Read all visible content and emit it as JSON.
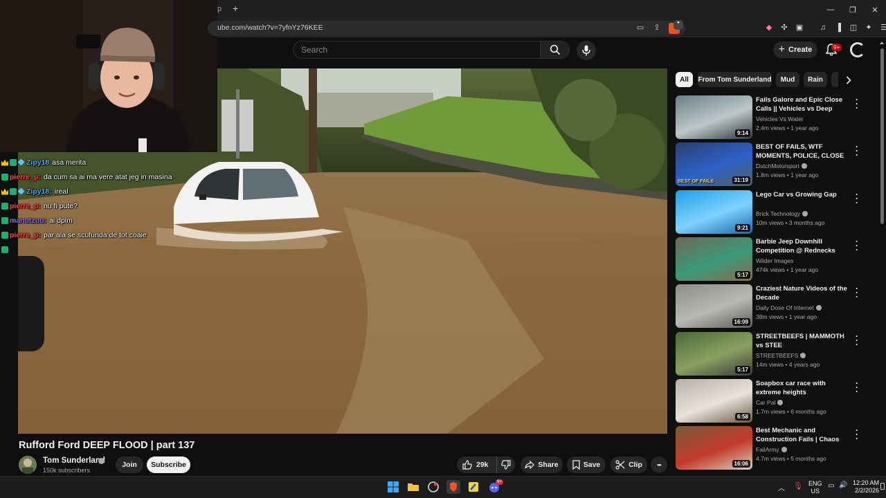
{
  "browser": {
    "tab_fragment": "p",
    "new_tab": "+",
    "url": "ube.com/watch?v=7yfnYz76KEE",
    "brave_badge": "●",
    "window_controls": [
      "—",
      "❐",
      "✕"
    ]
  },
  "header": {
    "search_placeholder": "Search",
    "create_label": "Create",
    "notifications_badge": "9+"
  },
  "chat": [
    {
      "badges": [
        "crown",
        "green",
        "diamond"
      ],
      "name": "Zipy18",
      "name_color": "blue",
      "message": "asa merita"
    },
    {
      "badges": [
        "green"
      ],
      "name": "pierre_p:",
      "name_color": "red",
      "message": "da cum sa ai ma vere atat jeg in masina"
    },
    {
      "badges": [
        "crown",
        "green",
        "diamond"
      ],
      "name": "Zipy18:",
      "name_color": "blue",
      "message": "ireal"
    },
    {
      "badges": [
        "green"
      ],
      "name": "pierre_p:",
      "name_color": "red",
      "message": "nu fi pute?"
    },
    {
      "badges": [
        "green"
      ],
      "name": "manutzuu:",
      "name_color": "purple",
      "message": "ai dplm"
    },
    {
      "badges": [
        "green"
      ],
      "name": "pierre_p:",
      "name_color": "red",
      "message": "par ala se scufunda de tot coaie"
    },
    {
      "badges": [
        "green"
      ],
      "name": "",
      "name_color": "red",
      "message": ""
    }
  ],
  "video": {
    "title": "Rufford Ford DEEP FLOOD | part 137",
    "channel": "Tom Sunderland",
    "subscribers": "150k subscribers",
    "join_label": "Join",
    "subscribe_label": "Subscribe",
    "likes": "29k",
    "share_label": "Share",
    "save_label": "Save",
    "clip_label": "Clip",
    "more_label": "•••"
  },
  "chips": [
    "All",
    "From Tom Sunderland",
    "Mud",
    "Rain"
  ],
  "recommendations": [
    {
      "title": "Fails Galore and Epic Close Calls || Vehicles vs Deep Water...",
      "channel": "Vehicles Vs Water",
      "verified": false,
      "views": "2.4m views",
      "age": "1 year ago",
      "duration": "9:14",
      "thumb_colors": [
        "#6d7f86",
        "#bcc7c8",
        "#2f3a40"
      ]
    },
    {
      "title": "BEST OF FAILS, WTF MOMENTS, POLICE, CLOSE ...",
      "channel": "DutchMotorsport",
      "verified": true,
      "views": "1.8m views",
      "age": "1 year ago",
      "duration": "31:19",
      "thumb_colors": [
        "#2c3f6d",
        "#2d62c9",
        "#53605a"
      ],
      "thumb_text": "BEST OF FAILS"
    },
    {
      "title": "Lego Car vs Growing Gap",
      "channel": "Brick Technology",
      "verified": true,
      "views": "10m views",
      "age": "3 months ago",
      "duration": "9:21",
      "thumb_colors": [
        "#1ea0e6",
        "#7fd1ff",
        "#1768a8"
      ]
    },
    {
      "title": "Barbie Jeep Downhill Competition @ Rednecks with ...",
      "channel": "Wilder Images",
      "verified": false,
      "views": "474k views",
      "age": "1 year ago",
      "duration": "5:17",
      "thumb_colors": [
        "#6b6a55",
        "#3a9a7a",
        "#8a6a4a"
      ]
    },
    {
      "title": "Craziest Nature Videos of the Decade",
      "channel": "Daily Dose Of Internet",
      "verified": true,
      "views": "38m views",
      "age": "1 year ago",
      "duration": "16:09",
      "thumb_colors": [
        "#8c8c8a",
        "#b9b8b3",
        "#5a5a56"
      ]
    },
    {
      "title": "STREETBEEFS | MAMMOTH vs STEE",
      "channel": "STREETBEEFS",
      "verified": true,
      "views": "14m views",
      "age": "4 years ago",
      "duration": "5:17",
      "thumb_colors": [
        "#4a6a3a",
        "#8aa060",
        "#3a3a3a"
      ]
    },
    {
      "title": "Soapbox car race with extreme heights",
      "channel": "Car Pal",
      "verified": true,
      "views": "1.7m views",
      "age": "6 months ago",
      "duration": "6:58",
      "thumb_colors": [
        "#b8b0a6",
        "#e8e2da",
        "#6a5a4a"
      ]
    },
    {
      "title": "Best Mechanic and Construction Fails | Chaos and...",
      "channel": "FailArmy",
      "verified": true,
      "views": "4.7m views",
      "age": "5 months ago",
      "duration": "16:06",
      "thumb_colors": [
        "#7a5a3a",
        "#c23a2a",
        "#d8d0c0"
      ]
    }
  ],
  "taskbar": {
    "lang_top": "ENG",
    "lang_bottom": "US",
    "time": "12:20 AM",
    "date": "2/2/2026",
    "discord_badge": "9+"
  }
}
